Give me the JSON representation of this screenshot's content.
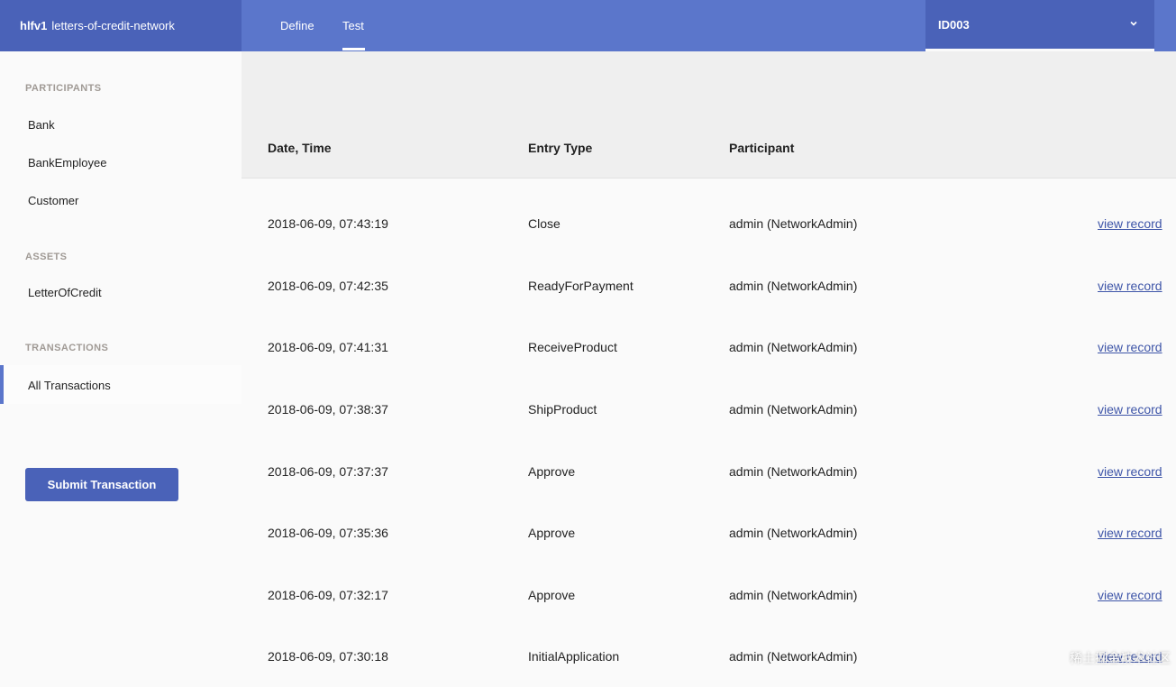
{
  "header": {
    "brand_bold": "hlfv1",
    "brand_name": "letters-of-credit-network",
    "tabs": [
      {
        "label": "Define"
      },
      {
        "label": "Test"
      }
    ],
    "identity": "ID003"
  },
  "sidebar": {
    "participants_title": "PARTICIPANTS",
    "participants": [
      {
        "label": "Bank"
      },
      {
        "label": "BankEmployee"
      },
      {
        "label": "Customer"
      }
    ],
    "assets_title": "ASSETS",
    "assets": [
      {
        "label": "LetterOfCredit"
      }
    ],
    "transactions_title": "TRANSACTIONS",
    "transactions": [
      {
        "label": "All Transactions"
      }
    ],
    "submit_label": "Submit Transaction"
  },
  "table": {
    "headers": {
      "datetime": "Date, Time",
      "entry_type": "Entry Type",
      "participant": "Participant"
    },
    "rows": [
      {
        "datetime": "2018-06-09, 07:43:19",
        "entry_type": "Close",
        "participant": "admin (NetworkAdmin)",
        "action": "view record"
      },
      {
        "datetime": "2018-06-09, 07:42:35",
        "entry_type": "ReadyForPayment",
        "participant": "admin (NetworkAdmin)",
        "action": "view record"
      },
      {
        "datetime": "2018-06-09, 07:41:31",
        "entry_type": "ReceiveProduct",
        "participant": "admin (NetworkAdmin)",
        "action": "view record"
      },
      {
        "datetime": "2018-06-09, 07:38:37",
        "entry_type": "ShipProduct",
        "participant": "admin (NetworkAdmin)",
        "action": "view record"
      },
      {
        "datetime": "2018-06-09, 07:37:37",
        "entry_type": "Approve",
        "participant": "admin (NetworkAdmin)",
        "action": "view record"
      },
      {
        "datetime": "2018-06-09, 07:35:36",
        "entry_type": "Approve",
        "participant": "admin (NetworkAdmin)",
        "action": "view record"
      },
      {
        "datetime": "2018-06-09, 07:32:17",
        "entry_type": "Approve",
        "participant": "admin (NetworkAdmin)",
        "action": "view record"
      },
      {
        "datetime": "2018-06-09, 07:30:18",
        "entry_type": "InitialApplication",
        "participant": "admin (NetworkAdmin)",
        "action": "view record"
      }
    ]
  },
  "watermark": "稀土掘金技术社区",
  "colors": {
    "primary": "#5b76cb",
    "primary_dark": "#4a62b8",
    "link": "#3e55a8"
  }
}
